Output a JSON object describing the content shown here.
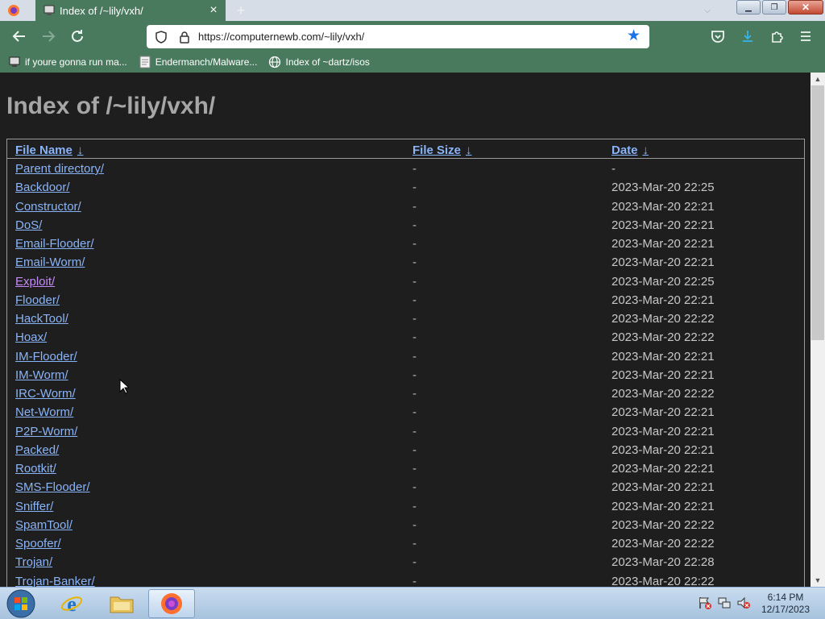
{
  "browser": {
    "tab_title": "Index of /~lily/vxh/",
    "url": "https://computernewb.com/~lily/vxh/",
    "bookmarks": [
      {
        "label": "if youre gonna run ma..."
      },
      {
        "label": "Endermanch/Malware..."
      },
      {
        "label": "Index of ~dartz/isos"
      }
    ]
  },
  "page": {
    "title": "Index of /~lily/vxh/",
    "columns": {
      "name": "File Name",
      "size": "File Size",
      "date": "Date",
      "sort_glyph": "↓"
    },
    "rows": [
      {
        "name": "Parent directory/",
        "size": "-",
        "date": "-"
      },
      {
        "name": "Backdoor/",
        "size": "-",
        "date": "2023-Mar-20 22:25"
      },
      {
        "name": "Constructor/",
        "size": "-",
        "date": "2023-Mar-20 22:21"
      },
      {
        "name": "DoS/",
        "size": "-",
        "date": "2023-Mar-20 22:21"
      },
      {
        "name": "Email-Flooder/",
        "size": "-",
        "date": "2023-Mar-20 22:21"
      },
      {
        "name": "Email-Worm/",
        "size": "-",
        "date": "2023-Mar-20 22:21"
      },
      {
        "name": "Exploit/",
        "size": "-",
        "date": "2023-Mar-20 22:25",
        "visited": true
      },
      {
        "name": "Flooder/",
        "size": "-",
        "date": "2023-Mar-20 22:21"
      },
      {
        "name": "HackTool/",
        "size": "-",
        "date": "2023-Mar-20 22:22"
      },
      {
        "name": "Hoax/",
        "size": "-",
        "date": "2023-Mar-20 22:22"
      },
      {
        "name": "IM-Flooder/",
        "size": "-",
        "date": "2023-Mar-20 22:21"
      },
      {
        "name": "IM-Worm/",
        "size": "-",
        "date": "2023-Mar-20 22:21"
      },
      {
        "name": "IRC-Worm/",
        "size": "-",
        "date": "2023-Mar-20 22:22"
      },
      {
        "name": "Net-Worm/",
        "size": "-",
        "date": "2023-Mar-20 22:21"
      },
      {
        "name": "P2P-Worm/",
        "size": "-",
        "date": "2023-Mar-20 22:21"
      },
      {
        "name": "Packed/",
        "size": "-",
        "date": "2023-Mar-20 22:21"
      },
      {
        "name": "Rootkit/",
        "size": "-",
        "date": "2023-Mar-20 22:21"
      },
      {
        "name": "SMS-Flooder/",
        "size": "-",
        "date": "2023-Mar-20 22:21"
      },
      {
        "name": "Sniffer/",
        "size": "-",
        "date": "2023-Mar-20 22:21"
      },
      {
        "name": "SpamTool/",
        "size": "-",
        "date": "2023-Mar-20 22:22"
      },
      {
        "name": "Spoofer/",
        "size": "-",
        "date": "2023-Mar-20 22:22"
      },
      {
        "name": "Trojan/",
        "size": "-",
        "date": "2023-Mar-20 22:28"
      },
      {
        "name": "Trojan-Banker/",
        "size": "-",
        "date": "2023-Mar-20 22:22"
      }
    ]
  },
  "taskbar": {
    "time": "6:14 PM",
    "date": "12/17/2023"
  },
  "colors": {
    "chrome_green": "#4a7a5e",
    "link": "#8ab4f8",
    "visited_link": "#c58af9",
    "page_bg": "#1e1e1e"
  }
}
